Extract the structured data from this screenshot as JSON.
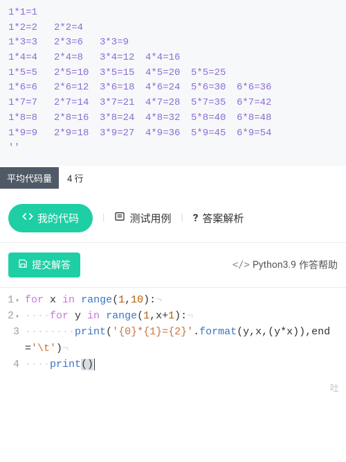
{
  "output": {
    "rows": [
      [
        "1*1=1"
      ],
      [
        "1*2=2",
        "2*2=4"
      ],
      [
        "1*3=3",
        "2*3=6",
        "3*3=9"
      ],
      [
        "1*4=4",
        "2*4=8",
        "3*4=12",
        "4*4=16"
      ],
      [
        "1*5=5",
        "2*5=10",
        "3*5=15",
        "4*5=20",
        "5*5=25"
      ],
      [
        "1*6=6",
        "2*6=12",
        "3*6=18",
        "4*6=24",
        "5*6=30",
        "6*6=36"
      ],
      [
        "1*7=7",
        "2*7=14",
        "3*7=21",
        "4*7=28",
        "5*7=35",
        "6*7=42"
      ],
      [
        "1*8=8",
        "2*8=16",
        "3*8=24",
        "4*8=32",
        "5*8=40",
        "6*8=48"
      ],
      [
        "1*9=9",
        "2*9=18",
        "3*9=27",
        "4*9=36",
        "5*9=45",
        "6*9=54"
      ]
    ],
    "trailing": "''"
  },
  "avg": {
    "label": "平均代码量",
    "value": "4 行"
  },
  "tabs": {
    "mycode": "我的代码",
    "testcase": "测试用例",
    "answer": "答案解析"
  },
  "actions": {
    "submit": "提交解答",
    "help_lang": "Python3.9",
    "help_text": "作答帮助"
  },
  "code": {
    "lines": [
      {
        "n": "1",
        "fold": true,
        "indent": 0,
        "tokens": [
          [
            "kw",
            "for"
          ],
          [
            "nm",
            " x "
          ],
          [
            "kw",
            "in"
          ],
          [
            "nm",
            " "
          ],
          [
            "fn",
            "range"
          ],
          [
            "op",
            "("
          ],
          [
            "num",
            "1"
          ],
          [
            "op",
            ","
          ],
          [
            "num",
            "10"
          ],
          [
            "op",
            ")"
          ],
          [
            "op",
            ":"
          ],
          [
            "ws",
            "¬"
          ]
        ]
      },
      {
        "n": "2",
        "fold": true,
        "indent": 1,
        "tokens": [
          [
            "kw",
            "for"
          ],
          [
            "nm",
            " y "
          ],
          [
            "kw",
            "in"
          ],
          [
            "nm",
            " "
          ],
          [
            "fn",
            "range"
          ],
          [
            "op",
            "("
          ],
          [
            "num",
            "1"
          ],
          [
            "op",
            ",x+"
          ],
          [
            "num",
            "1"
          ],
          [
            "op",
            ")"
          ],
          [
            "op",
            ":"
          ],
          [
            "ws",
            "¬"
          ]
        ]
      },
      {
        "n": "3",
        "fold": false,
        "indent": 2,
        "tokens": [
          [
            "fn",
            "print"
          ],
          [
            "op",
            "("
          ],
          [
            "str",
            "'{0}*{1}={2}'"
          ],
          [
            "op",
            "."
          ],
          [
            "fn",
            "format"
          ],
          [
            "op",
            "(y,x,(y*x)),end="
          ],
          [
            "str",
            "'\\t'"
          ],
          [
            "op",
            ")"
          ],
          [
            "ws",
            "¬"
          ]
        ]
      },
      {
        "n": "4",
        "fold": false,
        "indent": 1,
        "tokens": [
          [
            "fn",
            "print"
          ],
          [
            "hiopen",
            "("
          ],
          [
            "hiclose",
            ")"
          ]
        ],
        "cursor": true
      }
    ]
  },
  "bottom_edge": "吐"
}
